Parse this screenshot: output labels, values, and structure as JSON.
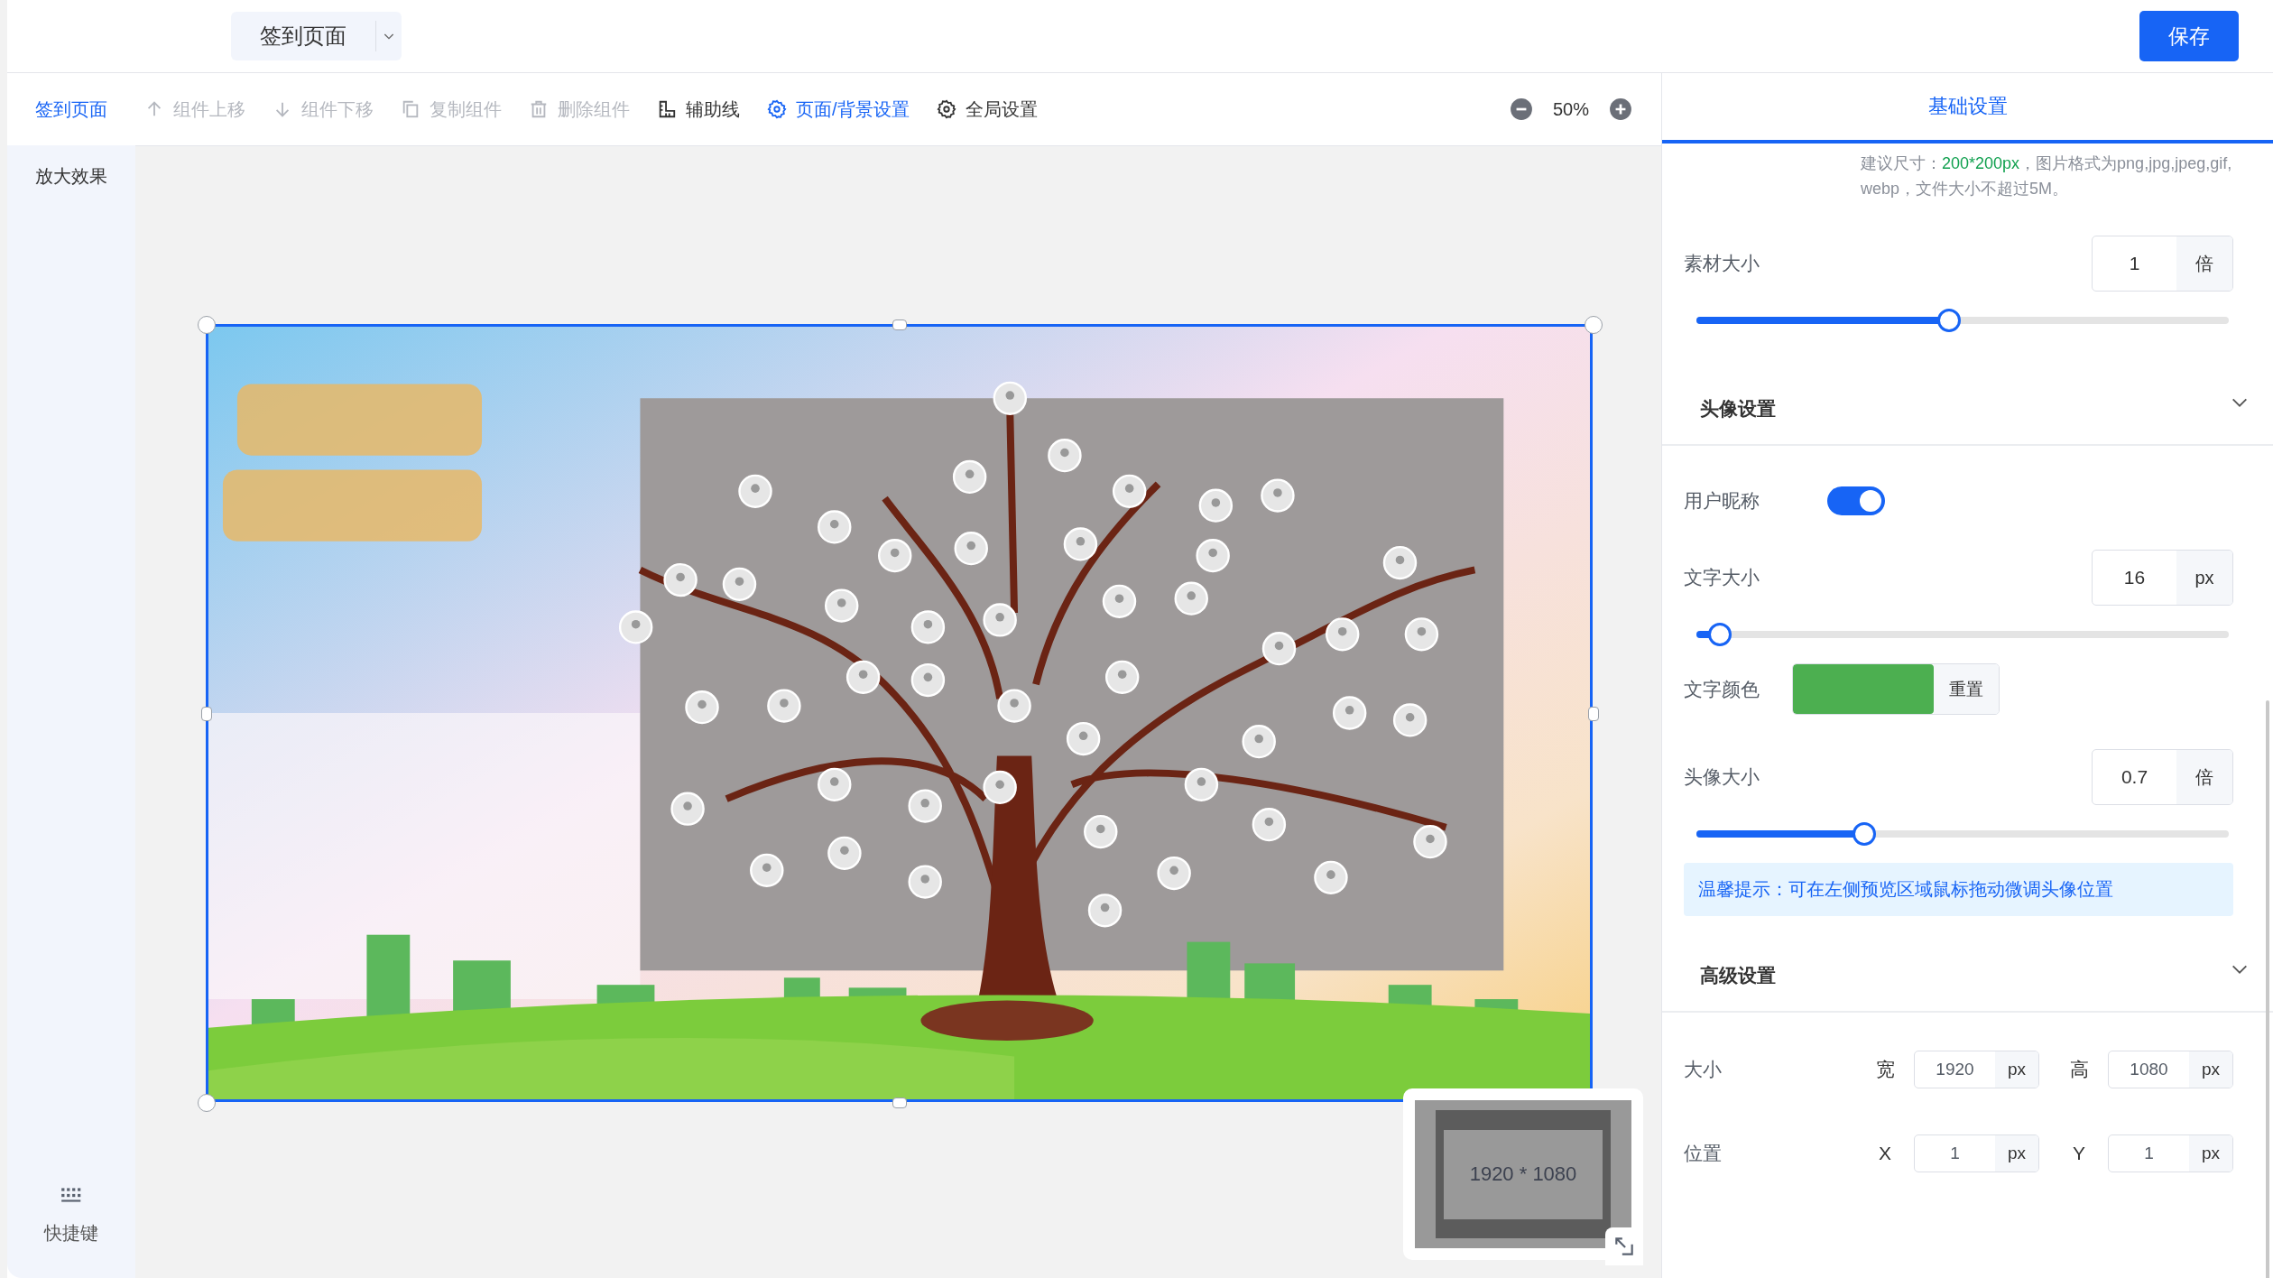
{
  "header": {
    "page_select": "签到页面",
    "save_button": "保存"
  },
  "pages": [
    {
      "label": "签到页面",
      "selected": true
    },
    {
      "label": "放大效果",
      "selected": false
    }
  ],
  "shortcuts": "快捷键",
  "toolbar": [
    {
      "label": "组件上移",
      "disabled": true,
      "selected": false
    },
    {
      "label": "组件下移",
      "disabled": true,
      "selected": false
    },
    {
      "label": "复制组件",
      "disabled": true,
      "selected": false
    },
    {
      "label": "删除组件",
      "disabled": true,
      "selected": false
    },
    {
      "label": "辅助线",
      "disabled": false,
      "selected": false
    },
    {
      "label": "页面/背景设置",
      "disabled": false,
      "selected": true
    },
    {
      "label": "全局设置",
      "disabled": false,
      "selected": false
    }
  ],
  "zoom": "50%",
  "minimap": {
    "size": "1920 * 1080"
  },
  "panel": {
    "tabs": [
      {
        "label": "基础设置",
        "selected": true
      }
    ],
    "hint": {
      "prefix": "建议尺寸：",
      "size": "200*200px",
      "suffix": "，图片格式为png,jpg,jpeg,gif,webp，文件大小不超过5M。"
    },
    "rows": [
      {
        "kind": "number",
        "label": "素材大小",
        "value": "1",
        "unit": "倍",
        "level": 0.475
      },
      {
        "kind": "section",
        "label": "头像设置"
      },
      {
        "kind": "toggle",
        "label": "用户昵称",
        "on": true
      },
      {
        "kind": "number",
        "label": "文字大小",
        "value": "16",
        "unit": "px",
        "level": 0.044
      },
      {
        "kind": "color",
        "label": "文字颜色",
        "color": "#4caf50",
        "button": "重置"
      },
      {
        "kind": "number",
        "label": "头像大小",
        "value": "0.7",
        "unit": "倍",
        "level": 0.315
      },
      {
        "kind": "tip",
        "text": "温馨提示：可在左侧预览区域鼠标拖动微调头像位置"
      },
      {
        "kind": "section",
        "label": "高级设置"
      },
      {
        "kind": "pair",
        "label": "大小",
        "fields": [
          {
            "label": "宽",
            "value": "1920",
            "unit": "px"
          },
          {
            "label": "高",
            "value": "1080",
            "unit": "px"
          }
        ]
      },
      {
        "kind": "pair",
        "label": "位置",
        "fields": [
          {
            "label": "X",
            "value": "1",
            "unit": "px"
          },
          {
            "label": "Y",
            "value": "1",
            "unit": "px"
          }
        ]
      }
    ]
  }
}
